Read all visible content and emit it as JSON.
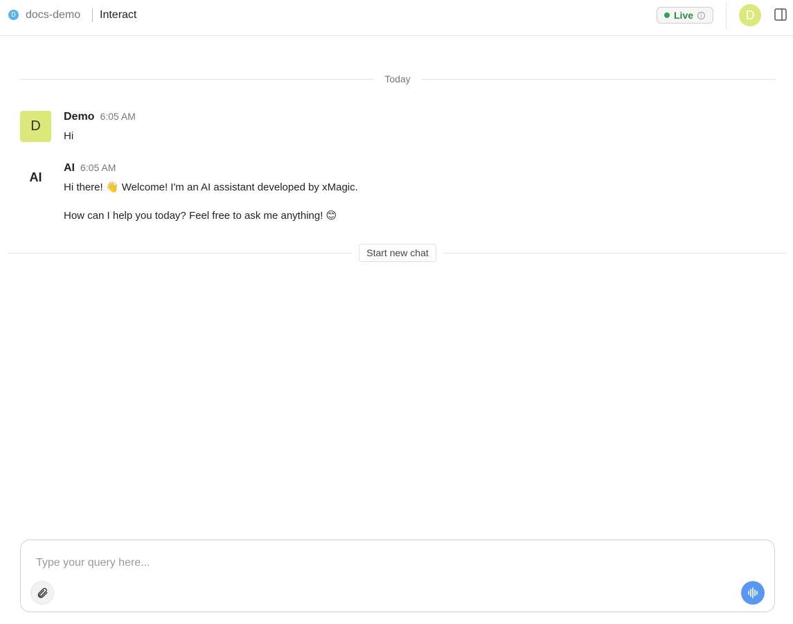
{
  "header": {
    "workspace_initial": "D",
    "workspace_name": "docs-demo",
    "page_title": "Interact",
    "live_label": "Live",
    "user_initial": "D"
  },
  "chat": {
    "date_divider": "Today",
    "messages": [
      {
        "author": "Demo",
        "avatar": "D",
        "time": "6:05 AM",
        "lines": [
          "Hi"
        ]
      },
      {
        "author": "AI",
        "avatar": "AI",
        "time": "6:05 AM",
        "lines": [
          "Hi there! 👋 Welcome! I'm an AI assistant developed by xMagic.",
          "How can I help you today? Feel free to ask me anything! 😊"
        ]
      }
    ],
    "new_chat_label": "Start new chat"
  },
  "composer": {
    "placeholder": "Type your query here...",
    "value": ""
  },
  "colors": {
    "accent": "#5a97ee",
    "live_green": "#2ea44f",
    "avatar_lime": "#dbe87a",
    "workspace_blue": "#5ab0f0"
  },
  "icons": {
    "info": "info-icon",
    "panel": "sidebar-panel-icon",
    "attach": "paperclip-icon",
    "voice": "waveform-icon"
  }
}
